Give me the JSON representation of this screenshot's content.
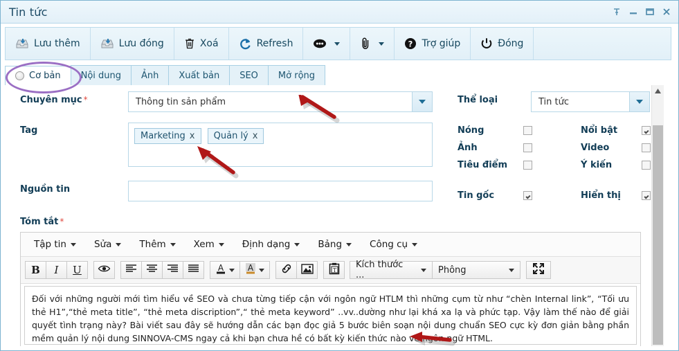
{
  "window": {
    "title": "Tin tức",
    "controls": [
      {
        "name": "pin-icon",
        "label": "Pin"
      },
      {
        "name": "minimize-icon",
        "label": "Minimize"
      },
      {
        "name": "maximize-icon",
        "label": "Maximize"
      },
      {
        "name": "close-icon",
        "label": "Close"
      }
    ]
  },
  "toolbar": {
    "items": [
      {
        "label": "Lưu thêm",
        "icon": "save-add-icon",
        "caret": false
      },
      {
        "label": "Lưu đóng",
        "icon": "save-close-icon",
        "caret": false
      },
      {
        "label": "Xoá",
        "icon": "trash-icon",
        "caret": false
      },
      {
        "label": "Refresh",
        "icon": "refresh-icon",
        "caret": false
      },
      {
        "label": "",
        "icon": "more-icon",
        "caret": true
      },
      {
        "label": "",
        "icon": "attachment-icon",
        "caret": true
      },
      {
        "label": "Trợ giúp",
        "icon": "help-icon",
        "caret": false
      },
      {
        "label": "Đóng",
        "icon": "power-icon",
        "caret": false
      }
    ]
  },
  "tabs": [
    {
      "label": "Cơ bản",
      "active": true,
      "radio": true
    },
    {
      "label": "Nội dung",
      "active": false,
      "radio": false
    },
    {
      "label": "Ảnh",
      "active": false,
      "radio": false
    },
    {
      "label": "Xuất bản",
      "active": false,
      "radio": false
    },
    {
      "label": "SEO",
      "active": false,
      "radio": false
    },
    {
      "label": "Mở rộng",
      "active": false,
      "radio": false
    }
  ],
  "form": {
    "category": {
      "label": "Chuyên mục",
      "required": "*",
      "value": "Thông tin sản phẩm"
    },
    "tag": {
      "label": "Tag",
      "tags": [
        {
          "text": "Marketing",
          "close": "x"
        },
        {
          "text": "Quản lý",
          "close": "x"
        }
      ]
    },
    "source": {
      "label": "Nguồn tin",
      "value": "",
      "placeholder": ""
    },
    "summary": {
      "label": "Tóm tắt",
      "required": "*"
    },
    "type": {
      "label": "Thể loại",
      "value": "Tin tức"
    },
    "flags": [
      {
        "label": "Nóng",
        "checked": false
      },
      {
        "label": "Nổi bật",
        "checked": true
      },
      {
        "label": "Ảnh",
        "checked": false
      },
      {
        "label": "Video",
        "checked": false
      },
      {
        "label": "Tiêu điểm",
        "checked": false
      },
      {
        "label": "Ý kiến",
        "checked": false
      }
    ],
    "flags2": [
      {
        "label": "Tin gốc",
        "checked": true
      },
      {
        "label": "Hiển thị",
        "checked": true
      }
    ]
  },
  "editor": {
    "menus": [
      {
        "label": "Tập tin"
      },
      {
        "label": "Sửa"
      },
      {
        "label": "Thêm"
      },
      {
        "label": "Xem"
      },
      {
        "label": "Định dạng"
      },
      {
        "label": "Bảng"
      },
      {
        "label": "Công cụ"
      }
    ],
    "fontsize_label": "Kích thước ...",
    "font_label": "Phông",
    "body": "Đối với những người mới tìm hiểu về SEO và chưa từng tiếp cận với ngôn ngữ HTLM thì những cụm từ như “chèn Internal link”, “Tối ưu thẻ H1”,“thẻ meta title”, “thẻ meta discription”,“ thẻ meta keyword” ..vv..dường như lại khá xa lạ và phức tạp. Vậy làm thế nào để giải quyết tình trạng này? Bài viết sau đây sẽ hướng dẫn các bạn đọc giả 5 bước biên soạn nội dung chuẩn SEO cực kỳ đơn giản bằng phần mềm quản lý nội dung SINNOVA-CMS ngay cả khi bạn chưa hề có bất kỳ kiến thức nào về ngôn ngữ HTML."
  },
  "colors": {
    "accent": "#1c4b66",
    "window_border": "#7db3d0",
    "titlebar": "#e9f4fa",
    "annotation_arrow": "#b01818",
    "annotation_ellipse": "#9b6fc4",
    "required": "#e04a3f"
  }
}
